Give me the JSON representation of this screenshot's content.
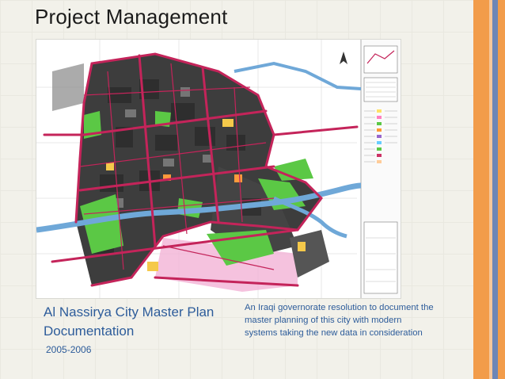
{
  "slide": {
    "title": "Project Management",
    "doc_title": "Al Nassirya City Master Plan Documentation",
    "years": "2005-2006",
    "description": "An Iraqi governorate resolution to document the master planning of this city with modern systems taking the new data in consideration"
  },
  "colors": {
    "accent_orange": "#f29c4a",
    "accent_blue": "#6e86b6",
    "text_blue": "#2d5c9a",
    "roads": "#c4245a",
    "blocks": "#3a3a3a",
    "green": "#5bc845",
    "water": "#6fa8d8"
  },
  "map": {
    "alt_icon": "city-master-plan-map"
  }
}
